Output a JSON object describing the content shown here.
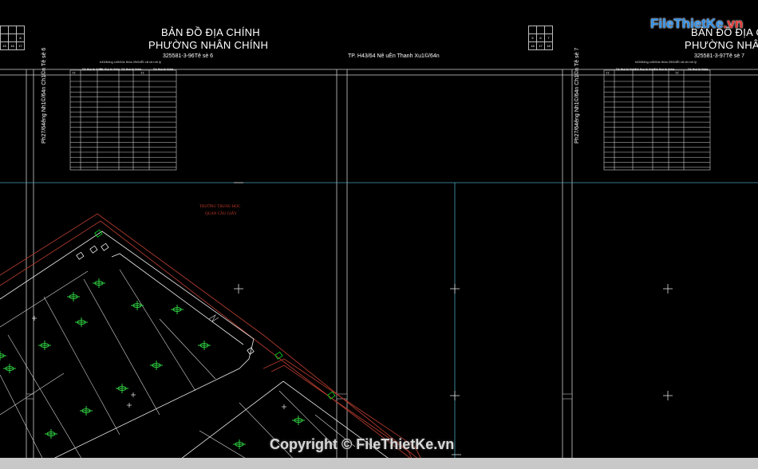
{
  "map": {
    "title_left_1": "BẢN ĐỒ ĐỊA CHÍNH",
    "title_left_2": "PHƯỜNG NHÂN CHÍNH",
    "title_right_1": "BẢN ĐỒ ĐỊA C",
    "title_right_2": "PHƯỜNG NHÂN",
    "code_left": "325581-3-96Tê sè 6",
    "code_right": "325581-3-97Tê sè 7",
    "center_caption": "TP. H43/64 Nê uÈn Thanh Xu1©/64n",
    "vertical_left": "Ph27/64êng Nh1©/64n Ch1©n  Tê sè 6",
    "vertical_right": "Ph27/64êng Nh1©/64n Ch1©n  Tê sè 7",
    "small_header_left": "b45/64ng c49/64c thöa 29/64Êt cã ch×nh lý",
    "small_header_right": "b45/64ng c49/64c thöa 29/64Êt cã ch×nh lý",
    "table_headers": [
      "TT",
      "Sè thø tù thöa",
      "Sè thø tù thöa",
      "Sè thø tù thöa",
      "TT",
      "Sè thø tù thöa"
    ],
    "sheet_grid_left": [
      "",
      "",
      "",
      "",
      "",
      "8",
      "15",
      "16",
      "17"
    ],
    "sheet_grid_right": [
      "",
      "",
      "",
      "5",
      "6",
      "7",
      "16",
      "17",
      "18"
    ],
    "red_label_1": "TRƯỜNG TRUNG HỌC",
    "red_label_2": "QUAN CẦU GIẤY"
  },
  "watermark": {
    "brand_left": "File",
    "brand_right": "ThietKe",
    "brand_domain": ".vn",
    "copyright": "Copyright © FileThietKe.vn"
  },
  "colors": {
    "background": "#000000",
    "grid": "#4aa3b8",
    "parcel": "#ffffff",
    "road": "#c0392b",
    "tree": "#2ecc40",
    "brand": "#2f8fe8"
  }
}
